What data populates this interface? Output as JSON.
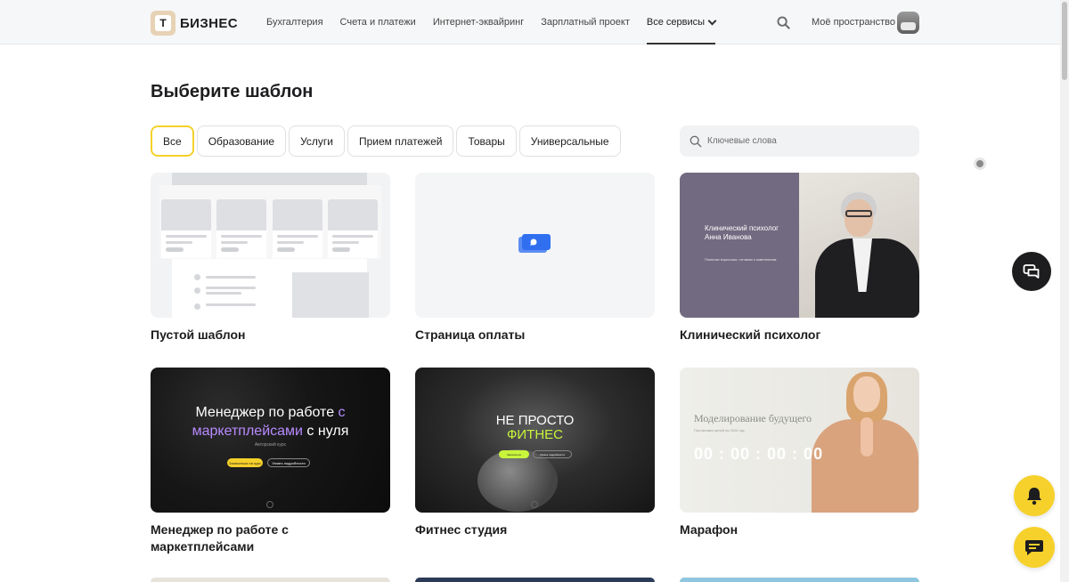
{
  "header": {
    "logo_letter": "Т",
    "logo_text": "БИЗНЕС",
    "nav": [
      {
        "label": "Бухгалтерия"
      },
      {
        "label": "Счета и платежи"
      },
      {
        "label": "Интернет-эквайринг"
      },
      {
        "label": "Зарплатный проект"
      },
      {
        "label": "Все сервисы",
        "active": true
      }
    ],
    "search_icon": "search-icon",
    "my_space_label": "Моё пространство"
  },
  "page": {
    "title": "Выберите шаблон"
  },
  "filters": [
    {
      "label": "Все",
      "active": true
    },
    {
      "label": "Образование"
    },
    {
      "label": "Услуги"
    },
    {
      "label": "Прием платежей"
    },
    {
      "label": "Товары"
    },
    {
      "label": "Универсальные"
    }
  ],
  "keywords": {
    "placeholder": "Ключевые слова"
  },
  "templates": [
    {
      "title": "Пустой шаблон"
    },
    {
      "title": "Страница оплаты"
    },
    {
      "title": "Клинический психолог",
      "preview_heading": "Клинический психолог Анна Иванова",
      "preview_sub": "Помогаю взрослым, готовым к изменениям"
    },
    {
      "title": "Менеджер по работе с маркетплейсами",
      "preview_heading_a": "Менеджер по работе",
      "preview_heading_hl": "с",
      "preview_heading_b": "маркетплейсами",
      "preview_heading_c": "с нуля",
      "preview_sub": "Авторский курс",
      "btn_primary": "Записаться на курс",
      "btn_secondary": "Узнать подробности"
    },
    {
      "title": "Фитнес студия",
      "preview_line1": "НЕ ПРОСТО",
      "preview_line2": "ФИТНЕС",
      "btn_primary": "Записаться",
      "btn_secondary": "Узнать подробности"
    },
    {
      "title": "Марафон",
      "preview_heading": "Моделирование будущего",
      "preview_sub": "Постановка целей на 2024 год",
      "timer": "00 : 00 : 00 : 00"
    }
  ],
  "colors": {
    "accent": "#f6d12b",
    "dark": "#1d1d1f"
  }
}
